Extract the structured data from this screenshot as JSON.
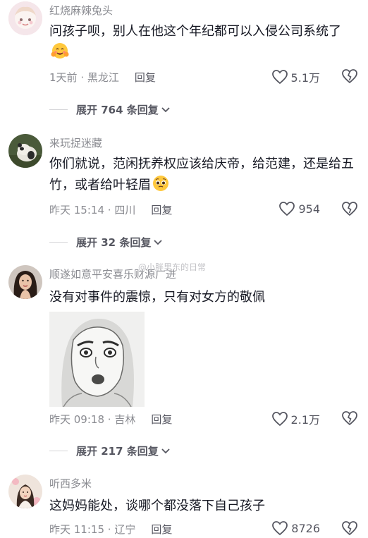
{
  "comments": [
    {
      "username": "红烧麻辣兔头",
      "text": "问孩子呗，别人在他这个年纪都可以入侵公司系统了",
      "time": "1天前",
      "location": "黑龙江",
      "reply_label": "回复",
      "likes": "5.1万",
      "emoji": "hugging-face-emoji",
      "expand_label": "展开 764 条回复"
    },
    {
      "username": "来玩捉迷藏",
      "text": "你们就说，范闲抚养权应该给庆帝，给范建，还是给五竹，或者给叶轻眉",
      "time": "昨天 15:14",
      "location": "四川",
      "reply_label": "回复",
      "likes": "954",
      "emoji": "pleading-face-emoji",
      "expand_label": "展开 32 条回复"
    },
    {
      "username": "顺遂如意平安喜乐财源广进",
      "text": "没有对事件的震惊，只有对女方的敬佩",
      "time": "昨天 09:18",
      "location": "吉林",
      "reply_label": "回复",
      "likes": "2.1万",
      "expand_label": "展开 217 条回复"
    },
    {
      "username": "听西多米",
      "text": "这妈妈能处，谈哪个都没落下自己孩子",
      "time": "昨天 11:15",
      "location": "辽宁",
      "reply_label": "回复",
      "likes": "8726"
    }
  ],
  "watermark": "@小胖里东的日常",
  "colors": {
    "username": "#8a8b91",
    "text": "#161823",
    "meta": "#8a8b91"
  }
}
